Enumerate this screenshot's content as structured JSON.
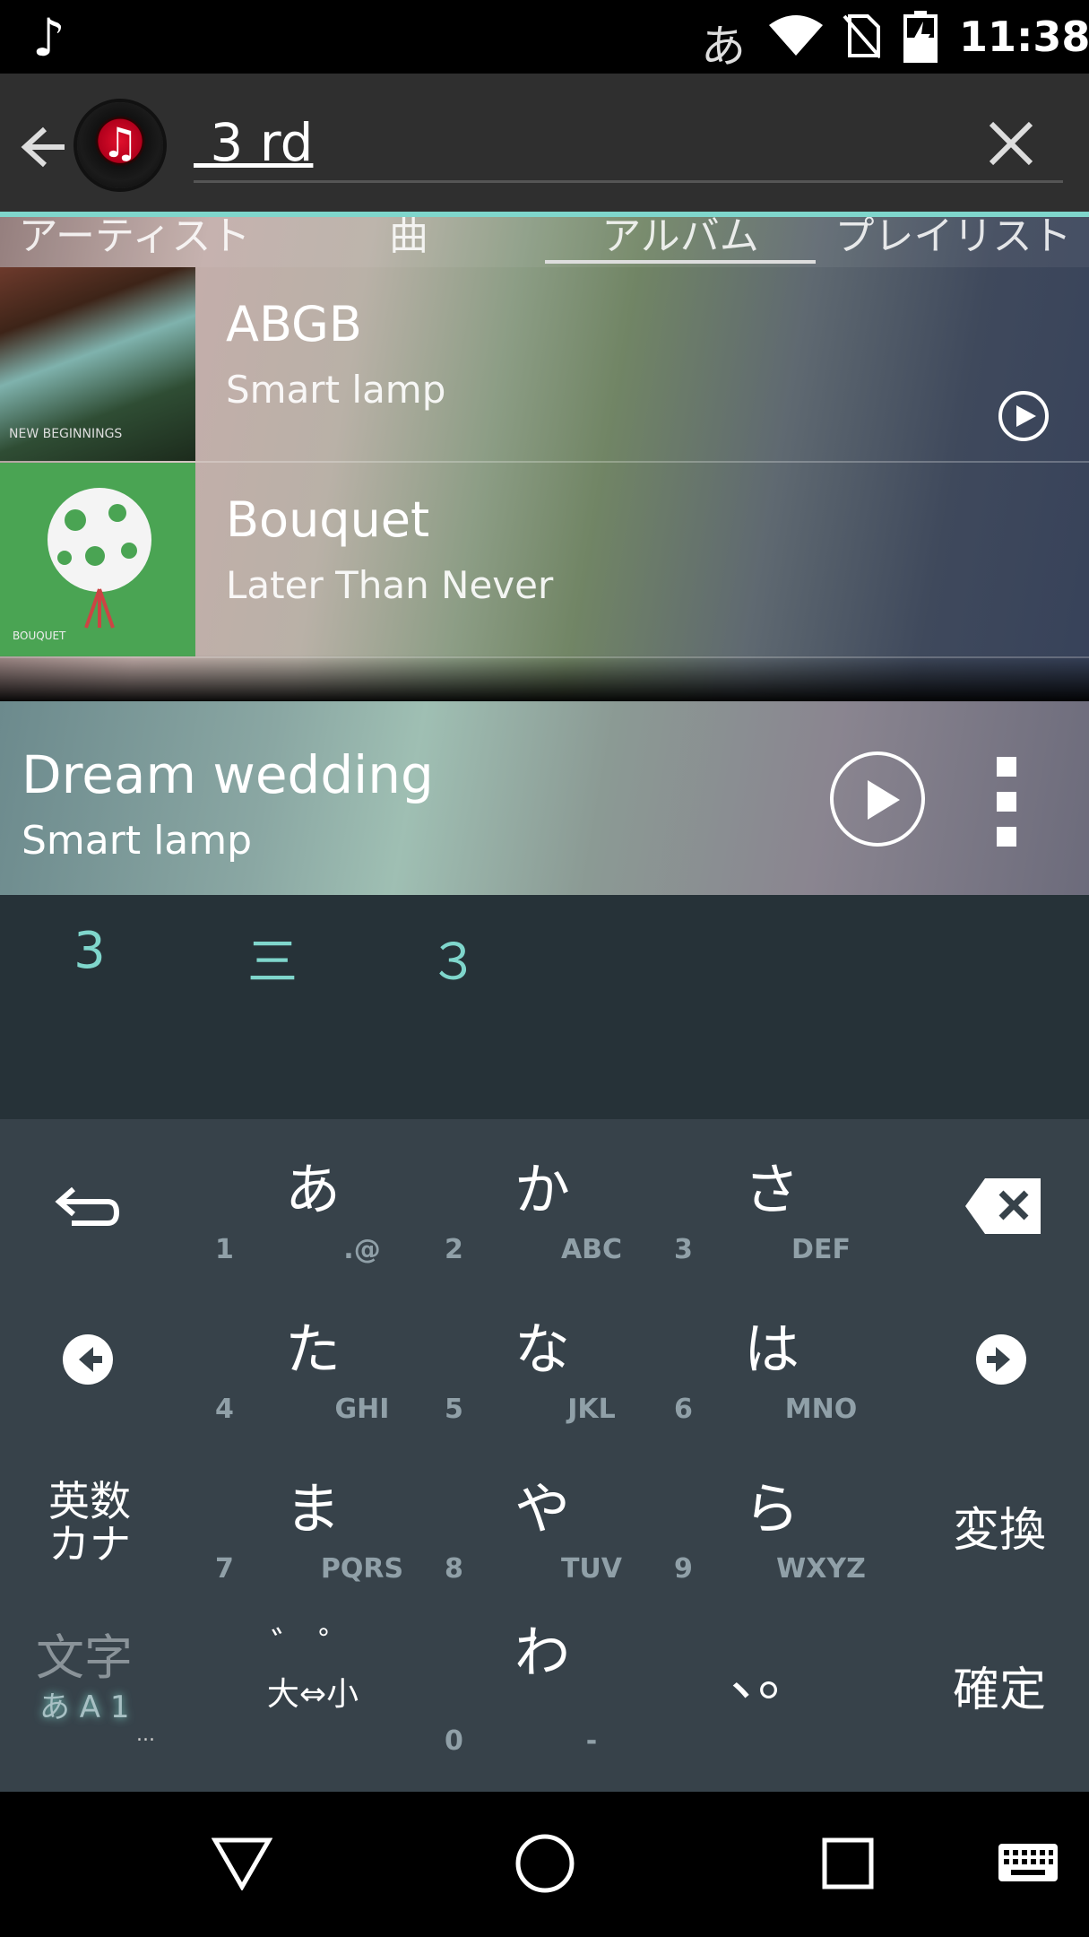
{
  "status_bar": {
    "time": "11:38",
    "ime_indicator": "あ",
    "left_icon": "music-note-icon",
    "icons": [
      "wifi-icon",
      "no-sim-icon",
      "battery-charging-icon"
    ]
  },
  "toolbar": {
    "search_value": " 3 rd",
    "app_logo_icon": "music-app-logo-icon"
  },
  "tabs": [
    {
      "label": "アーティスト"
    },
    {
      "label": "曲"
    },
    {
      "label": "アルバム",
      "selected": true
    },
    {
      "label": "プレイリスト"
    }
  ],
  "albums": [
    {
      "title": "ABGB",
      "artist": "Smart lamp",
      "cover_text": "NEW BEGINNINGS"
    },
    {
      "title": "Bouquet",
      "artist": "Later Than Never",
      "cover_text": "BOUQUET"
    }
  ],
  "now_playing": {
    "title": "Dream wedding",
    "artist": "Smart lamp"
  },
  "candidates": [
    "3",
    "三",
    "３"
  ],
  "keyboard": {
    "keys": [
      {
        "kana": "あ",
        "num": "1",
        "latin": ".@"
      },
      {
        "kana": "か",
        "num": "2",
        "latin": "ABC"
      },
      {
        "kana": "さ",
        "num": "3",
        "latin": "DEF"
      },
      {
        "kana": "た",
        "num": "4",
        "latin": "GHI"
      },
      {
        "kana": "な",
        "num": "5",
        "latin": "JKL"
      },
      {
        "kana": "は",
        "num": "6",
        "latin": "MNO"
      },
      {
        "kana": "ま",
        "num": "7",
        "latin": "PQRS"
      },
      {
        "kana": "や",
        "num": "8",
        "latin": "TUV"
      },
      {
        "kana": "ら",
        "num": "9",
        "latin": "WXYZ"
      },
      {
        "kana": "わ",
        "num": "0",
        "latin": "-"
      }
    ],
    "eisu_kana": "英数\nカナ",
    "henkan": "変換",
    "kakutei": "確定",
    "mode_label": "文字",
    "mode_sub": "あ A 1",
    "mode_ellipsis": "...",
    "dakuten_top": "゛ ゜",
    "dakuten_bottom": "大⇔小",
    "punct": "、。",
    "accent_color": "#7fd6cc"
  },
  "nav_bar": {
    "icons": [
      "back-triangle-icon",
      "home-circle-icon",
      "recents-square-icon",
      "keyboard-icon"
    ]
  }
}
